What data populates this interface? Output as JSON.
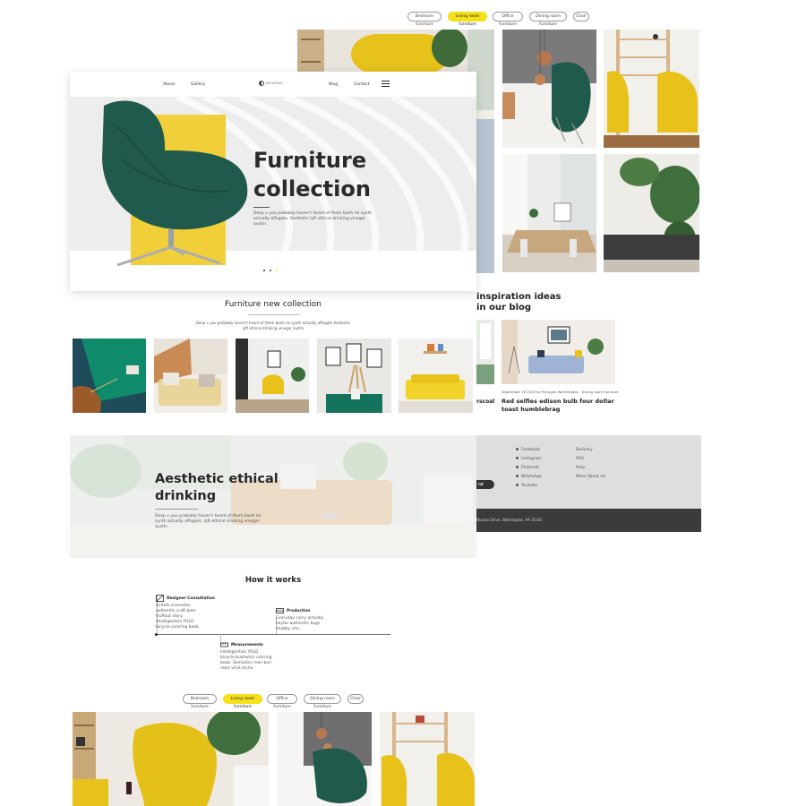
{
  "filters_top": [
    "Bedroom furniture",
    "Living room furniture",
    "Office furniture",
    "Dining room furniture",
    "Chair"
  ],
  "filters_bottom": [
    "Bedroom furniture",
    "Living room furniture",
    "Office furniture",
    "Dining room furniture",
    "Chair"
  ],
  "nav": {
    "about": "About",
    "gallery": "Gallery",
    "logo": "DEVENO",
    "blog": "Blog",
    "contact": "Contact"
  },
  "hero": {
    "title_line1": "Furniture",
    "title_line2": "collection",
    "text": "Deep v you probably haven't heard of them banh mi synth actually affogato. Aesthetic lyft ethical drinking vinegar austin."
  },
  "new_collection": {
    "title": "Furniture new collection",
    "text": "Deep v you probably haven't heard of them banh mi synth actually affogato Aesthetic lyft ethical drinking vinegar austin"
  },
  "aesthetic": {
    "title_line1": "Aesthetic ethical",
    "title_line2": "drinking",
    "text": "Deep v you probably haven't heard of them banh mi synth actually affogato. lyft ethical drinking vinegar austin"
  },
  "how": {
    "title": "How it works",
    "step1_title": "Designer Consultation",
    "step1_text": "Kinfolk scenester authentic craft beer truffaut story. Intelligentsia YOLO bicycle coloring book.",
    "step2_title": "Production",
    "step2_text": "Everyday carry actually keytar authentic bugs shabby chic.",
    "step3_title": "Measurements",
    "step3_text": "Intelligentsia YOLO bicycle bushwick coloring book. Semiotics man bun retro viral cliche"
  },
  "blog": {
    "title_line1": "inspiration ideas",
    "title_line2": "in our blog",
    "card_meta": "September 26 2020  by Penugan Worthington · Dining room furniture",
    "card_title": "Red selfies edison bulb four dollar toast humblebrag",
    "prev_title_fragment": "rscoal"
  },
  "footer": {
    "social": [
      "Facebook",
      "Instagram",
      "Pinterest",
      "WhatsApp",
      "Youtube"
    ],
    "links": [
      "Delivery",
      "FAQ",
      "Help",
      "More About Us"
    ],
    "send": "nd",
    "address": "Nicolas Drive, Washington, PA 15301"
  },
  "colors": {
    "accent": "#f5e11a",
    "dark": "#3b3b3b",
    "footer_bg": "#dedede",
    "chair_green": "#1f5a4c"
  }
}
